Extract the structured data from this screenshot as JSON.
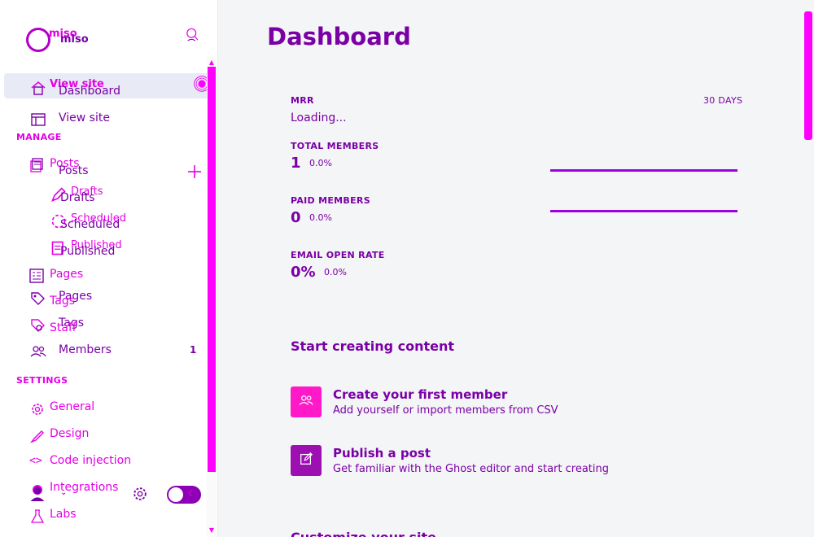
{
  "brand": {
    "logo_top": "miso",
    "logo_name": "miso"
  },
  "sidebar": {
    "overlay_view_site": "View site",
    "dashboard": "Dashboard",
    "view_site": "View site",
    "manage_header": "MANAGE",
    "posts_overlay": "Posts",
    "posts": "Posts",
    "drafts_overlay": "Drafts",
    "drafts": "Drafts",
    "scheduled_overlay": "Scheduled",
    "scheduled": "Scheduled",
    "published_overlay": "Published",
    "published": "Published",
    "pages_overlay": "Pages",
    "pages": "Pages",
    "tags_overlay": "Tags",
    "tags": "Tags",
    "staff_overlay": "Staff",
    "members": "Members",
    "members_count": "1",
    "settings_header": "SETTINGS",
    "general": "General",
    "design": "Design",
    "code_injection": "Code injection",
    "integrations": "Integrations",
    "labs": "Labs"
  },
  "main": {
    "title": "Dashboard",
    "mrr_label": "MRR",
    "range_label": "30 DAYS",
    "mrr_value": "Loading...",
    "total_members_label": "TOTAL MEMBERS",
    "total_members_value": "1",
    "total_members_pct": "0.0%",
    "paid_members_label": "PAID MEMBERS",
    "paid_members_value": "0",
    "paid_members_pct": "0.0%",
    "email_open_label": "EMAIL OPEN RATE",
    "email_open_value": "0%",
    "email_open_pct": "0.0%",
    "start_creating": "Start creating content",
    "card1_title": "Create your first member",
    "card1_desc": "Add yourself or import members from CSV",
    "card2_title": "Publish a post",
    "card2_desc": "Get familiar with the Ghost editor and start creating",
    "customize_partial": "Customize your site"
  },
  "colors": {
    "magenta": "#ff00ff",
    "purple": "#7a00a6",
    "accent_line": "#9d00e0",
    "card1_bg": "#ff19c8",
    "card2_bg": "#9c0fb0"
  }
}
